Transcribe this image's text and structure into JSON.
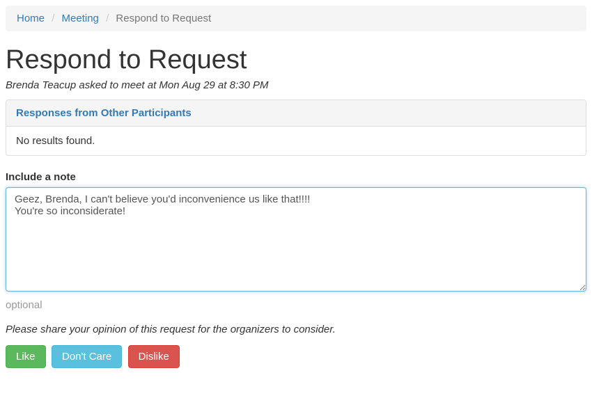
{
  "breadcrumb": {
    "home": "Home",
    "meeting": "Meeting",
    "current": "Respond to Request"
  },
  "page_title": "Respond to Request",
  "subtitle": "Brenda Teacup asked to meet at Mon Aug 29 at 8:30 PM",
  "panel": {
    "heading": "Responses from Other Participants",
    "body": "No results found."
  },
  "note": {
    "label": "Include a note",
    "value": "Geez, Brenda, I can't believe you'd inconvenience us like that!!!!\nYou're so inconsiderate!",
    "help": "optional"
  },
  "instruction": "Please share your opinion of this request for the organizers to consider.",
  "buttons": {
    "like": "Like",
    "dont_care": "Don't Care",
    "dislike": "Dislike"
  }
}
